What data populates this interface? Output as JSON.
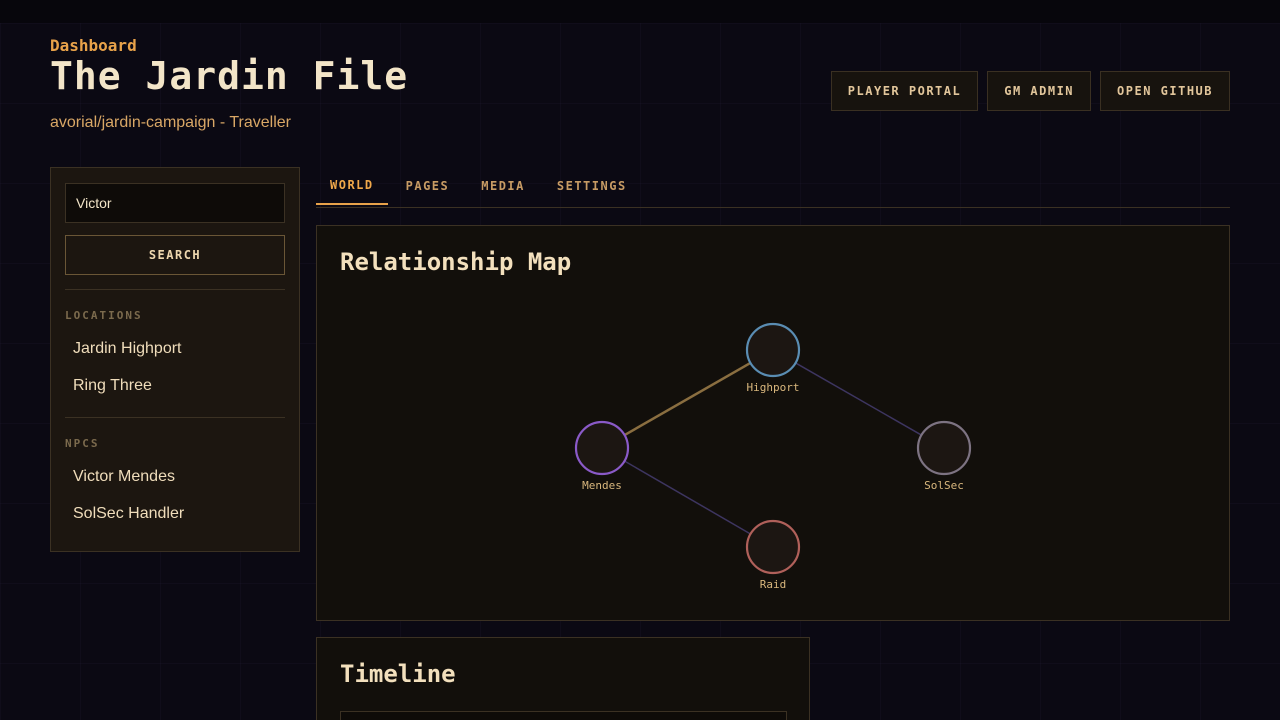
{
  "header": {
    "eyebrow": "Dashboard",
    "title": "The Jardin File",
    "subtitle": "avorial/jardin-campaign - Traveller",
    "actions": [
      "PLAYER PORTAL",
      "GM ADMIN",
      "OPEN GITHUB"
    ]
  },
  "sidebar": {
    "search_value": "Victor",
    "search_button": "SEARCH",
    "sections": [
      {
        "label": "LOCATIONS",
        "items": [
          "Jardin Highport",
          "Ring Three"
        ]
      },
      {
        "label": "NPCS",
        "items": [
          "Victor Mendes",
          "SolSec Handler"
        ]
      }
    ]
  },
  "tabs": [
    "WORLD",
    "PAGES",
    "MEDIA",
    "SETTINGS"
  ],
  "active_tab": "WORLD",
  "relationship_map": {
    "title": "Relationship Map",
    "nodes": [
      {
        "id": "highport",
        "label": "Highport",
        "color": "#5a8db3"
      },
      {
        "id": "mendes",
        "label": "Mendes",
        "color": "#8a5ac8"
      },
      {
        "id": "solsec",
        "label": "SolSec",
        "color": "#7d7382"
      },
      {
        "id": "raid",
        "label": "Raid",
        "color": "#b0605a"
      }
    ],
    "edges": [
      {
        "from": "mendes",
        "to": "highport",
        "color": "#8a6e40"
      },
      {
        "from": "highport",
        "to": "solsec",
        "color": "#3d3560"
      },
      {
        "from": "mendes",
        "to": "raid",
        "color": "#3d3560"
      }
    ]
  },
  "timeline": {
    "title": "Timeline"
  },
  "colors": {
    "accent": "#e8a24a",
    "background": "#0b0913",
    "panel": "#120f0b"
  }
}
